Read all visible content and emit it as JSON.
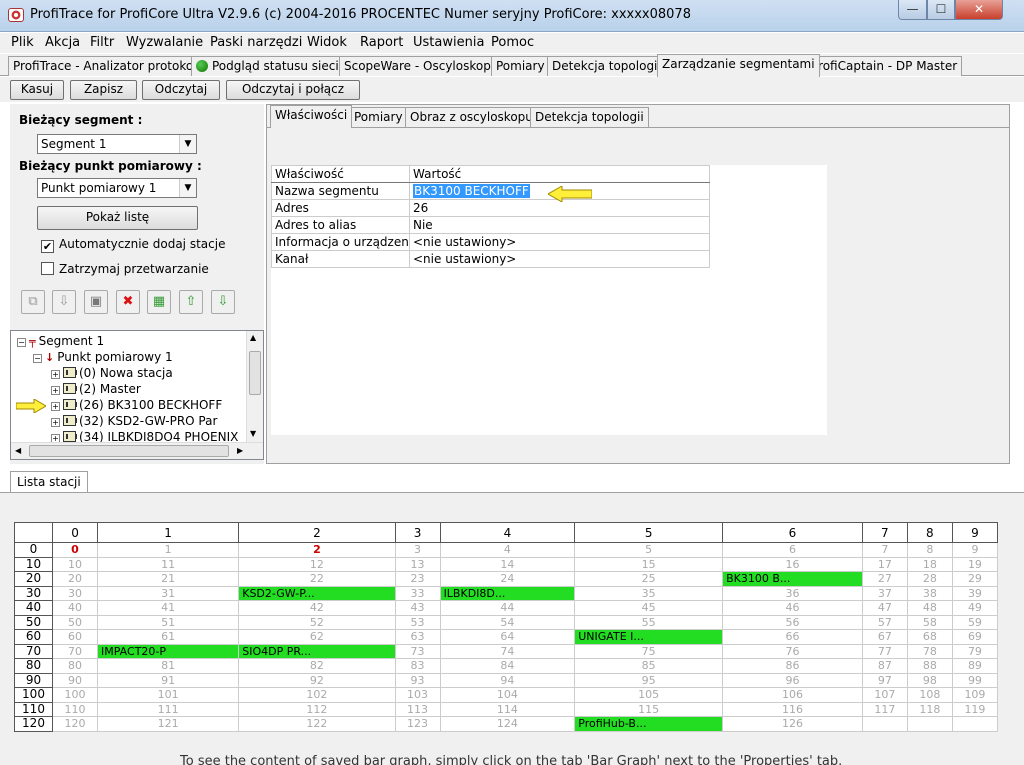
{
  "window": {
    "title": "ProfiTrace for ProfiCore Ultra V2.9.6 (c) 2004-2016 PROCENTEC  Numer seryjny ProfiCore: xxxxx08078",
    "min": "—",
    "max": "☐",
    "close": "✕"
  },
  "menu": [
    "Plik",
    "Akcja",
    "Filtr",
    "Wyzwalanie",
    "Paski narzędzi",
    "Widok",
    "Raport",
    "Ustawienia",
    "Pomoc"
  ],
  "main_tabs": [
    "ProfiTrace - Analizator protokołu",
    "Podgląd statusu sieci",
    "ScopeWare - Oscyloskop",
    "Pomiary",
    "Detekcja topologii",
    "Zarządzanie segmentami",
    "ProfiCaptain - DP Master"
  ],
  "toolbar": [
    "Kasuj",
    "Zapisz",
    "Odczytaj",
    "Odczytaj i połącz"
  ],
  "left": {
    "segment_label": "Bieżący segment :",
    "segment_value": "Segment 1",
    "point_label": "Bieżący punkt pomiarowy :",
    "point_value": "Punkt pomiarowy 1",
    "show_list": "Pokaż listę",
    "auto_add": "Automatycznie dodaj stacje",
    "auto_add_checked": "✔",
    "stop_processing": "Zatrzymaj przetwarzanie"
  },
  "tree": {
    "segment": "Segment 1",
    "point": "Punkt pomiarowy 1",
    "stations": [
      "(0) Nowa stacja",
      "(2) Master",
      "(26) BK3100 BECKHOFF",
      "(32) KSD2-GW-PRO Par",
      "(34) ILBKDI8DO4 PHOENIX"
    ]
  },
  "sub_tabs": [
    "Właściwości",
    "Pomiary",
    "Obraz z oscyloskopu",
    "Detekcja topologii"
  ],
  "properties": {
    "headers": [
      "Właściwość",
      "Wartość"
    ],
    "rows": [
      [
        "Nazwa segmentu",
        "BK3100 BECKHOFF"
      ],
      [
        "Adres",
        "26"
      ],
      [
        "Adres to alias",
        "Nie"
      ],
      [
        "Informacja o urządzeniach",
        "<nie ustawiony>"
      ],
      [
        "Kanał",
        "<nie ustawiony>"
      ]
    ]
  },
  "bottom_tab": "Lista stacji",
  "grid": {
    "columns": [
      "0",
      "1",
      "2",
      "3",
      "4",
      "5",
      "6",
      "7",
      "8",
      "9"
    ],
    "rows": [
      "0",
      "10",
      "20",
      "30",
      "40",
      "50",
      "60",
      "70",
      "80",
      "90",
      "100",
      "110",
      "120"
    ],
    "active": {
      "0": "0",
      "2": "2"
    },
    "devices": {
      "26": "BK3100 B...",
      "32": "KSD2-GW-P...",
      "34": "ILBKDI8D...",
      "65": "UNIGATE I...",
      "71": "IMPACT20-P",
      "72": "SIO4DP PR...",
      "125": "ProfiHub-B..."
    }
  },
  "footnote": "To see the content of saved bar graph, simply click on the tab 'Bar Graph' next to the 'Properties' tab."
}
